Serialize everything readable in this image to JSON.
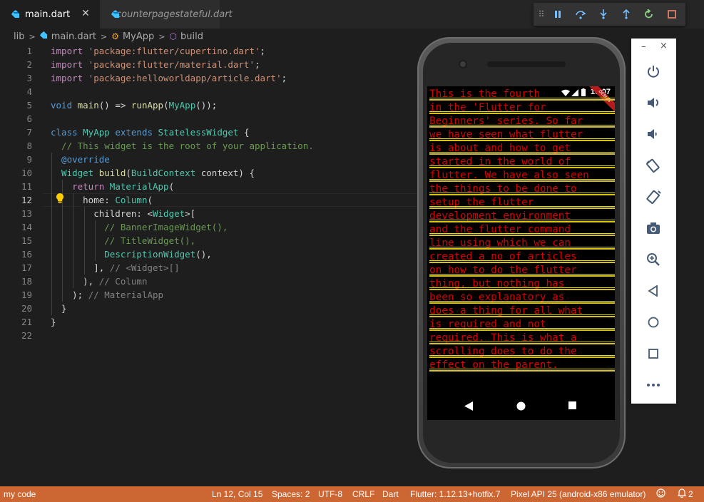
{
  "tabs": [
    {
      "label": "main.dart",
      "active": true
    },
    {
      "label": "counterpagestateful.dart",
      "active": false
    }
  ],
  "breadcrumb": {
    "items": [
      "lib",
      "main.dart",
      "MyApp",
      "build"
    ]
  },
  "editor": {
    "line_numbers": [
      "1",
      "2",
      "3",
      "4",
      "5",
      "6",
      "7",
      "8",
      "9",
      "10",
      "11",
      "12",
      "13",
      "14",
      "15",
      "16",
      "17",
      "18",
      "19",
      "20",
      "21",
      "22"
    ],
    "lines": [
      [
        {
          "t": "import ",
          "c": "kw2"
        },
        {
          "t": "'package:flutter/cupertino.dart'",
          "c": "str"
        },
        {
          "t": ";",
          "c": "pl"
        }
      ],
      [
        {
          "t": "import ",
          "c": "kw2"
        },
        {
          "t": "'package:flutter/material.dart'",
          "c": "str"
        },
        {
          "t": ";",
          "c": "pl"
        }
      ],
      [
        {
          "t": "import ",
          "c": "kw2"
        },
        {
          "t": "'package:helloworldapp/article.dart'",
          "c": "str"
        },
        {
          "t": ";",
          "c": "pl"
        }
      ],
      [],
      [
        {
          "t": "void ",
          "c": "kw"
        },
        {
          "t": "main",
          "c": "fn"
        },
        {
          "t": "() => ",
          "c": "pl"
        },
        {
          "t": "runApp",
          "c": "fn"
        },
        {
          "t": "(",
          "c": "pl"
        },
        {
          "t": "MyApp",
          "c": "ty"
        },
        {
          "t": "());",
          "c": "pl"
        }
      ],
      [],
      [
        {
          "t": "class ",
          "c": "kw"
        },
        {
          "t": "MyApp ",
          "c": "ty"
        },
        {
          "t": "extends ",
          "c": "kw"
        },
        {
          "t": "StatelessWidget",
          "c": "ty"
        },
        {
          "t": " {",
          "c": "pl"
        }
      ],
      [
        {
          "t": "  // This widget is the root of your application.",
          "c": "cm"
        }
      ],
      [
        {
          "t": "  @override",
          "c": "kw"
        }
      ],
      [
        {
          "t": "  Widget ",
          "c": "ty"
        },
        {
          "t": "build",
          "c": "fn"
        },
        {
          "t": "(",
          "c": "pl"
        },
        {
          "t": "BuildContext",
          "c": "ty"
        },
        {
          "t": " context) {",
          "c": "pl"
        }
      ],
      [
        {
          "t": "    return ",
          "c": "kw2"
        },
        {
          "t": "MaterialApp",
          "c": "ty"
        },
        {
          "t": "(",
          "c": "pl"
        }
      ],
      [
        {
          "t": "      home: ",
          "c": "pl"
        },
        {
          "t": "Column",
          "c": "ty"
        },
        {
          "t": "(",
          "c": "pl"
        }
      ],
      [
        {
          "t": "        children: <",
          "c": "pl"
        },
        {
          "t": "Widget",
          "c": "ty"
        },
        {
          "t": ">[",
          "c": "pl"
        }
      ],
      [
        {
          "t": "          // BannerImageWidget(),",
          "c": "cm"
        }
      ],
      [
        {
          "t": "          // TitleWidget(),",
          "c": "cm"
        }
      ],
      [
        {
          "t": "          ",
          "c": "pl"
        },
        {
          "t": "DescriptionWidget",
          "c": "ty"
        },
        {
          "t": "(),",
          "c": "pl"
        }
      ],
      [
        {
          "t": "        ], ",
          "c": "pl"
        },
        {
          "t": "// <Widget>[]",
          "c": "gray"
        }
      ],
      [
        {
          "t": "      ), ",
          "c": "pl"
        },
        {
          "t": "// Column",
          "c": "gray"
        }
      ],
      [
        {
          "t": "    ); ",
          "c": "pl"
        },
        {
          "t": "// MaterialApp",
          "c": "gray"
        }
      ],
      [
        {
          "t": "  }",
          "c": "pl"
        }
      ],
      [
        {
          "t": "}",
          "c": "pl"
        }
      ],
      []
    ]
  },
  "emulator": {
    "time": "10:07",
    "banner": "DEBUG",
    "app_lines": [
      "This is the fourth",
      "in the 'Flutter for",
      "Beginners' series. So far",
      "we have seen what flutter",
      "is about and how to get",
      "started in the world of",
      "flutter. We have also seen",
      "the things to be done to",
      "setup the flutter",
      "development environment",
      "and the flutter command",
      "line using which we can",
      "created a no of articles",
      "on how to do the flutter",
      "thing, but nothing has",
      "been so explanatory as",
      "does a thing for all what",
      "is required and not",
      "required. This is what a",
      "scrolling does to do the",
      "effect on the parent."
    ],
    "side_panel": {
      "minimize": "–",
      "close": "×",
      "buttons": [
        "power-icon",
        "volume-up-icon",
        "volume-down-icon",
        "rotate-left-icon",
        "rotate-right-icon",
        "camera-icon",
        "zoom-icon",
        "back-icon",
        "home-icon",
        "overview-icon",
        "more-icon"
      ]
    }
  },
  "statusbar": {
    "left": "my code",
    "position": "Ln 12, Col 15",
    "spaces": "Spaces: 2",
    "encoding": "UTF-8",
    "eol": "CRLF",
    "language": "Dart",
    "flutter": "Flutter: 1.12.13+hotfix.7",
    "device": "Pixel API 25 (android-x86 emulator)",
    "notifications": "2"
  },
  "colors": {
    "editor_bg": "#1e1e1e",
    "status_bg": "#cc6633",
    "app_text": "#d50000",
    "underline": "#d6c21a"
  }
}
